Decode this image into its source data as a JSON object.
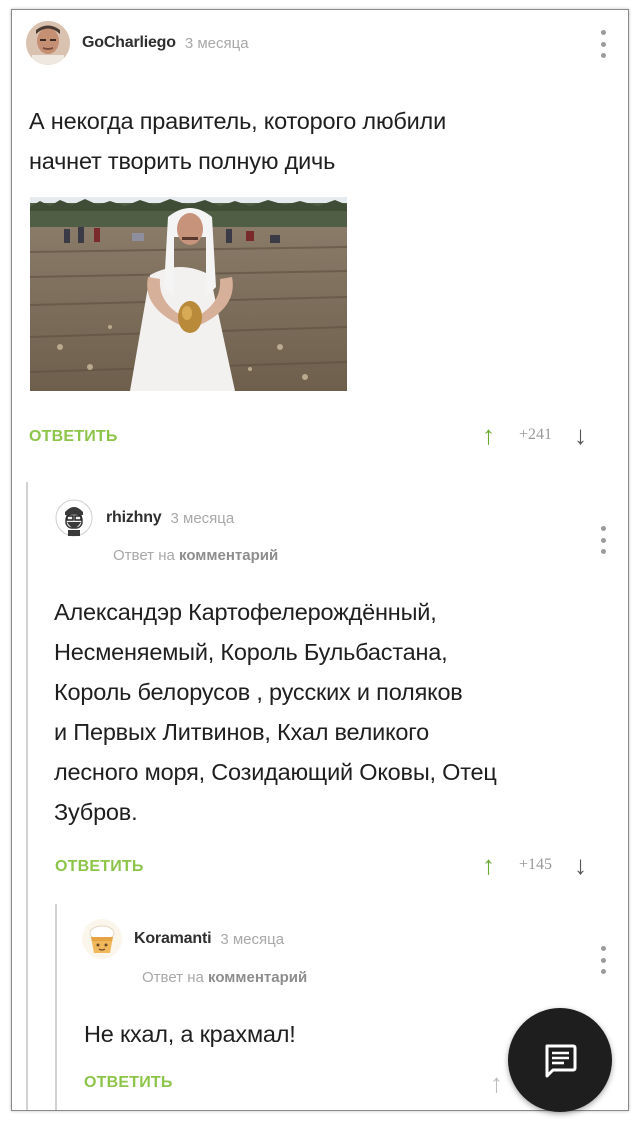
{
  "comments": [
    {
      "username": "GoCharliego",
      "time": "3 месяца",
      "text_lines": [
        "А некогда правитель, которого любили",
        "начнет творить полную дичь"
      ],
      "image_alt": "photo",
      "reply_label": "ОТВЕТИТЬ",
      "score": "+241"
    },
    {
      "username": "rhizhny",
      "time": "3 месяца",
      "reply_to_prefix": "Ответ на",
      "reply_to_target": "комментарий",
      "text_lines": [
        "Александэр Картофелерождённый,",
        "Несменяемый, Король Бульбастана,",
        "Король белорусов , русских и поляков",
        "и Первых Литвинов, Кхал великого",
        "лесного моря, Созидающий Оковы, Отец",
        "Зубров."
      ],
      "reply_label": "ОТВЕТИТЬ",
      "score": "+145"
    },
    {
      "username": "Koramanti",
      "time": "3 месяца",
      "reply_to_prefix": "Ответ на",
      "reply_to_target": "комментарий",
      "text_lines": [
        "Не кхал, а крахмал!"
      ],
      "reply_label": "ОТВЕТИТЬ"
    }
  ],
  "icons": {
    "upvote": "arrow-up-icon",
    "downvote": "arrow-down-icon",
    "more": "more-vertical-icon",
    "fab": "comment-icon"
  },
  "colors": {
    "accent_green": "#8dc44a",
    "upvote_green": "#6aaa2f",
    "muted_text": "#a8a8a8",
    "fab_bg": "#1e1e1e"
  }
}
